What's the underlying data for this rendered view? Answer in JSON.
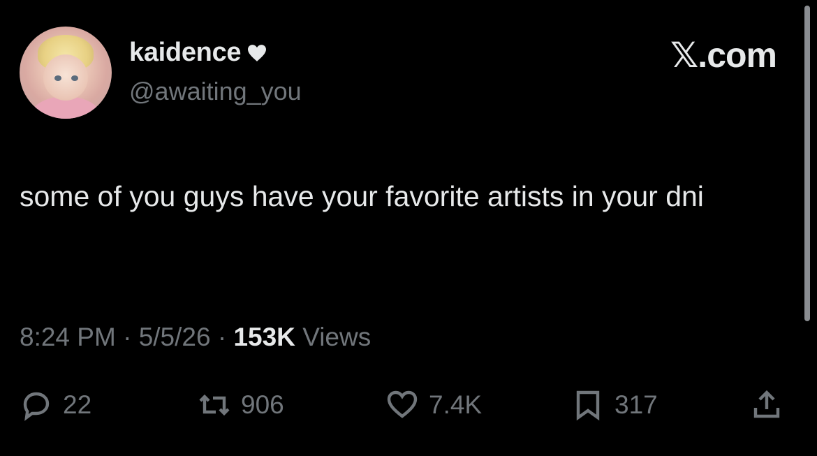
{
  "tweet": {
    "display_name": "kaidence",
    "handle": "@awaiting_you",
    "brand": "𝕏.com",
    "text": "some of you guys have your favorite artists in your dni",
    "time": "8:24 PM",
    "date": "5/5/26",
    "separator": "·",
    "views_count": "153K",
    "views_label": "Views"
  },
  "actions": {
    "replies": "22",
    "reposts": "906",
    "likes": "7.4K",
    "bookmarks": "317"
  },
  "icons": {
    "name_badge": "heart-icon",
    "reply": "comment-icon",
    "repost": "retweet-icon",
    "like": "heart-outline-icon",
    "bookmark": "bookmark-icon",
    "share": "share-icon"
  },
  "colors": {
    "background": "#000000",
    "primary_text": "#e7e9ea",
    "secondary_text": "#71767b"
  }
}
